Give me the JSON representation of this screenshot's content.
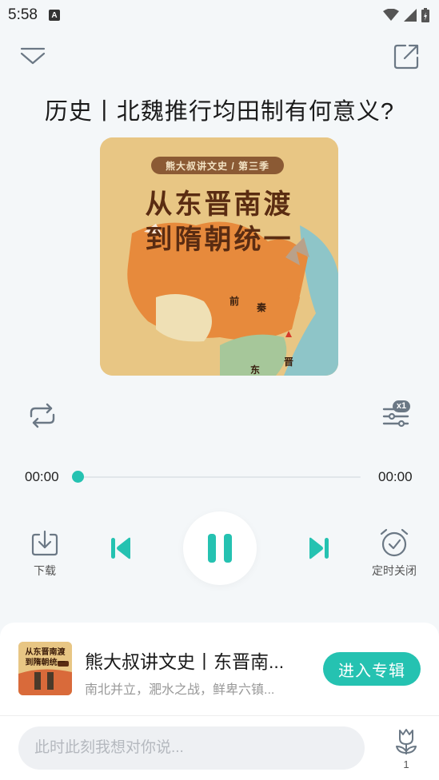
{
  "status_bar": {
    "time": "5:58",
    "notification_badge": "A",
    "icons": [
      "wifi-icon",
      "signal-icon",
      "battery-charging-icon"
    ]
  },
  "header": {
    "collapse_icon": "chevron-down-icon",
    "share_icon": "share-external-icon"
  },
  "episode": {
    "title": "历史丨北魏推行均田制有何意义?"
  },
  "cover": {
    "tag": "熊大叔讲文史 / 第三季",
    "line1": "从东晋南渡",
    "line2": "到隋朝统一",
    "map_labels": [
      "前",
      "秦",
      "东",
      "晋"
    ]
  },
  "controls": {
    "repeat_icon": "repeat-icon",
    "speed_icon": "speed-settings-icon",
    "speed_badge": "x1"
  },
  "progress": {
    "current": "00:00",
    "total": "00:00",
    "fraction": 0
  },
  "playback": {
    "download_label": "下载",
    "timer_label": "定时关闭",
    "prev_icon": "skip-previous-icon",
    "pause_icon": "pause-icon",
    "next_icon": "skip-next-icon"
  },
  "album": {
    "title": "熊大叔讲文史丨东晋南...",
    "subtitle": "南北并立，淝水之战，鲜卑六镇...",
    "button": "进入专辑",
    "thumb_line1": "从东晋南渡",
    "thumb_line2": "到隋朝统一"
  },
  "comment": {
    "placeholder": "此时此刻我想对你说...",
    "flower_count": "1"
  },
  "colors": {
    "accent": "#25c2b1",
    "background": "#f4f7f9"
  }
}
